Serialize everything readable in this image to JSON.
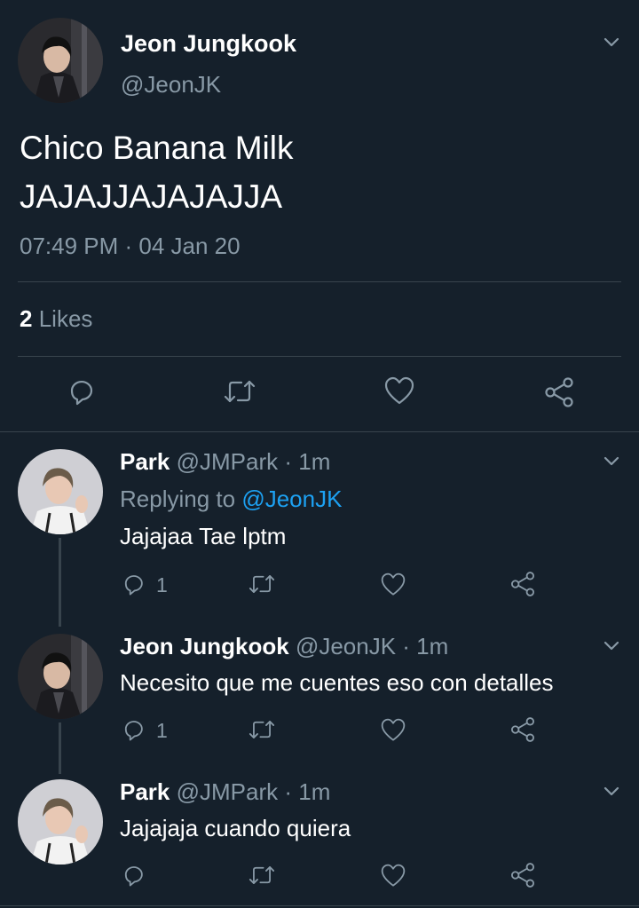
{
  "main_tweet": {
    "display_name": "Jeon Jungkook",
    "handle": "@JeonJK",
    "text_line1": "Chico Banana Milk",
    "text_line2": "JAJAJJAJAJAJJA",
    "timestamp": "07:49 PM · 04 Jan 20",
    "likes_count": "2",
    "likes_label": "Likes",
    "actions": [
      "reply-icon",
      "retweet-icon",
      "like-icon",
      "share-icon"
    ]
  },
  "replies": [
    {
      "display_name": "Park",
      "handle": "@JMPark",
      "time": "· 1m",
      "replying_prefix": "Replying to",
      "replying_to": "@JeonJK",
      "text": "Jajajaa Tae lptm",
      "reply_count": "1"
    },
    {
      "display_name": "Jeon Jungkook",
      "handle": "@JeonJK",
      "time": "· 1m",
      "text": "Necesito que me cuentes eso con detalles",
      "reply_count": "1"
    },
    {
      "display_name": "Park",
      "handle": "@JMPark",
      "time": "· 1m",
      "text": "Jajajaja cuando quiera",
      "reply_count": ""
    }
  ],
  "colors": {
    "background": "#15202b",
    "muted": "#8899a6",
    "accent": "#1da1f2",
    "divider": "#38444d"
  }
}
